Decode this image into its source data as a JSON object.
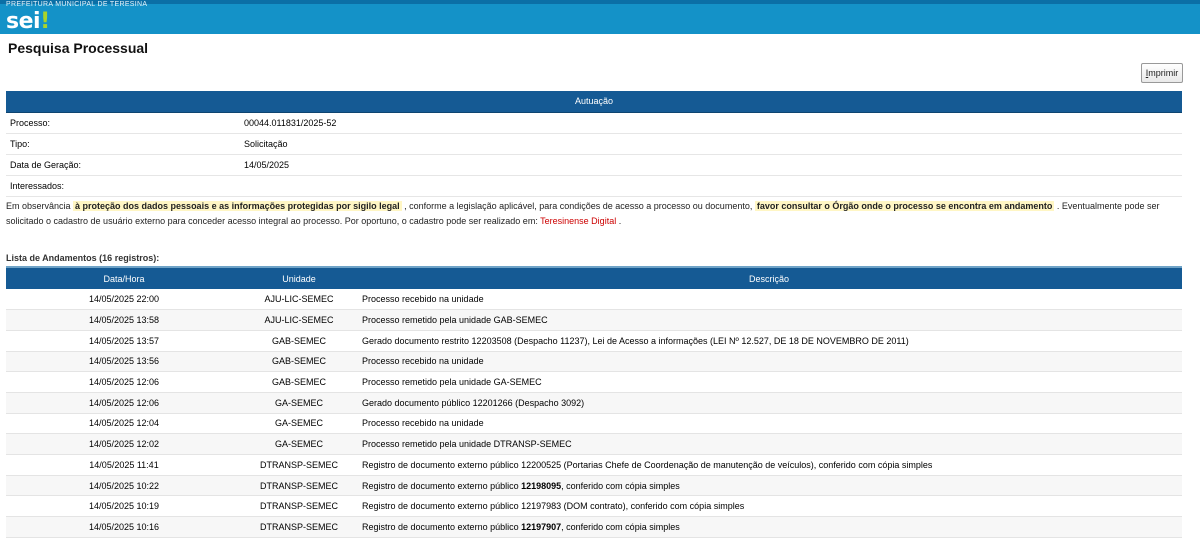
{
  "header": {
    "org_text": "PREFEITURA MUNICIPAL DE TERESINA",
    "logo_main": "sei",
    "logo_dot": "!"
  },
  "page": {
    "title": "Pesquisa Processual"
  },
  "toolbar": {
    "print_label_first": "I",
    "print_label_rest": "mprimir"
  },
  "autuacao": {
    "header": "Autuação",
    "rows": [
      {
        "label": "Processo:",
        "value": "00044.011831/2025-52"
      },
      {
        "label": "Tipo:",
        "value": "Solicitação"
      },
      {
        "label": "Data de Geração:",
        "value": "14/05/2025"
      },
      {
        "label": "Interessados:",
        "value": ""
      }
    ]
  },
  "notice": {
    "part1": "Em observância ",
    "hl1": "à proteção dos dados pessoais e as informações protegidas por sigilo legal",
    "part2": " , conforme a legislação aplicável, para condições de acesso a processo ou documento, ",
    "hl2": "favor consultar o Órgão onde o processo se encontra em andamento",
    "part3": " . Eventualmente pode ser solicitado o cadastro de usuário externo para conceder acesso integral ao processo. Por oportuno, o cadastro pode ser realizado em: ",
    "link": "Teresinense Digital",
    "part4": " ."
  },
  "andamentos": {
    "title": "Lista de Andamentos (16 registros):",
    "columns": {
      "date": "Data/Hora",
      "unit": "Unidade",
      "desc": "Descrição"
    },
    "rows": [
      {
        "date": "14/05/2025 22:00",
        "unit": "AJU-LIC-SEMEC",
        "desc": "Processo recebido na unidade",
        "bold": "",
        "desc2": ""
      },
      {
        "date": "14/05/2025 13:58",
        "unit": "AJU-LIC-SEMEC",
        "desc": "Processo remetido pela unidade GAB-SEMEC",
        "bold": "",
        "desc2": ""
      },
      {
        "date": "14/05/2025 13:57",
        "unit": "GAB-SEMEC",
        "desc": "Gerado documento restrito 12203508 (Despacho 11237), Lei de Acesso a informações (LEI Nº 12.527, DE 18 DE NOVEMBRO DE 2011)",
        "bold": "",
        "desc2": ""
      },
      {
        "date": "14/05/2025 13:56",
        "unit": "GAB-SEMEC",
        "desc": "Processo recebido na unidade",
        "bold": "",
        "desc2": ""
      },
      {
        "date": "14/05/2025 12:06",
        "unit": "GAB-SEMEC",
        "desc": "Processo remetido pela unidade GA-SEMEC",
        "bold": "",
        "desc2": ""
      },
      {
        "date": "14/05/2025 12:06",
        "unit": "GA-SEMEC",
        "desc": "Gerado documento público 12201266 (Despacho 3092)",
        "bold": "",
        "desc2": ""
      },
      {
        "date": "14/05/2025 12:04",
        "unit": "GA-SEMEC",
        "desc": "Processo recebido na unidade",
        "bold": "",
        "desc2": ""
      },
      {
        "date": "14/05/2025 12:02",
        "unit": "GA-SEMEC",
        "desc": "Processo remetido pela unidade DTRANSP-SEMEC",
        "bold": "",
        "desc2": ""
      },
      {
        "date": "14/05/2025 11:41",
        "unit": "DTRANSP-SEMEC",
        "desc": "Registro de documento externo público 12200525 (Portarias Chefe de Coordenação de manutenção de veículos), conferido com cópia simples",
        "bold": "",
        "desc2": ""
      },
      {
        "date": "14/05/2025 10:22",
        "unit": "DTRANSP-SEMEC",
        "desc": "Registro de documento externo público ",
        "bold": "12198095",
        "desc2": ", conferido com cópia simples"
      },
      {
        "date": "14/05/2025 10:19",
        "unit": "DTRANSP-SEMEC",
        "desc": "Registro de documento externo público 12197983 (DOM contrato), conferido com cópia simples",
        "bold": "",
        "desc2": ""
      },
      {
        "date": "14/05/2025 10:16",
        "unit": "DTRANSP-SEMEC",
        "desc": "Registro de documento externo público ",
        "bold": "12197907",
        "desc2": ", conferido com cópia simples"
      }
    ]
  }
}
